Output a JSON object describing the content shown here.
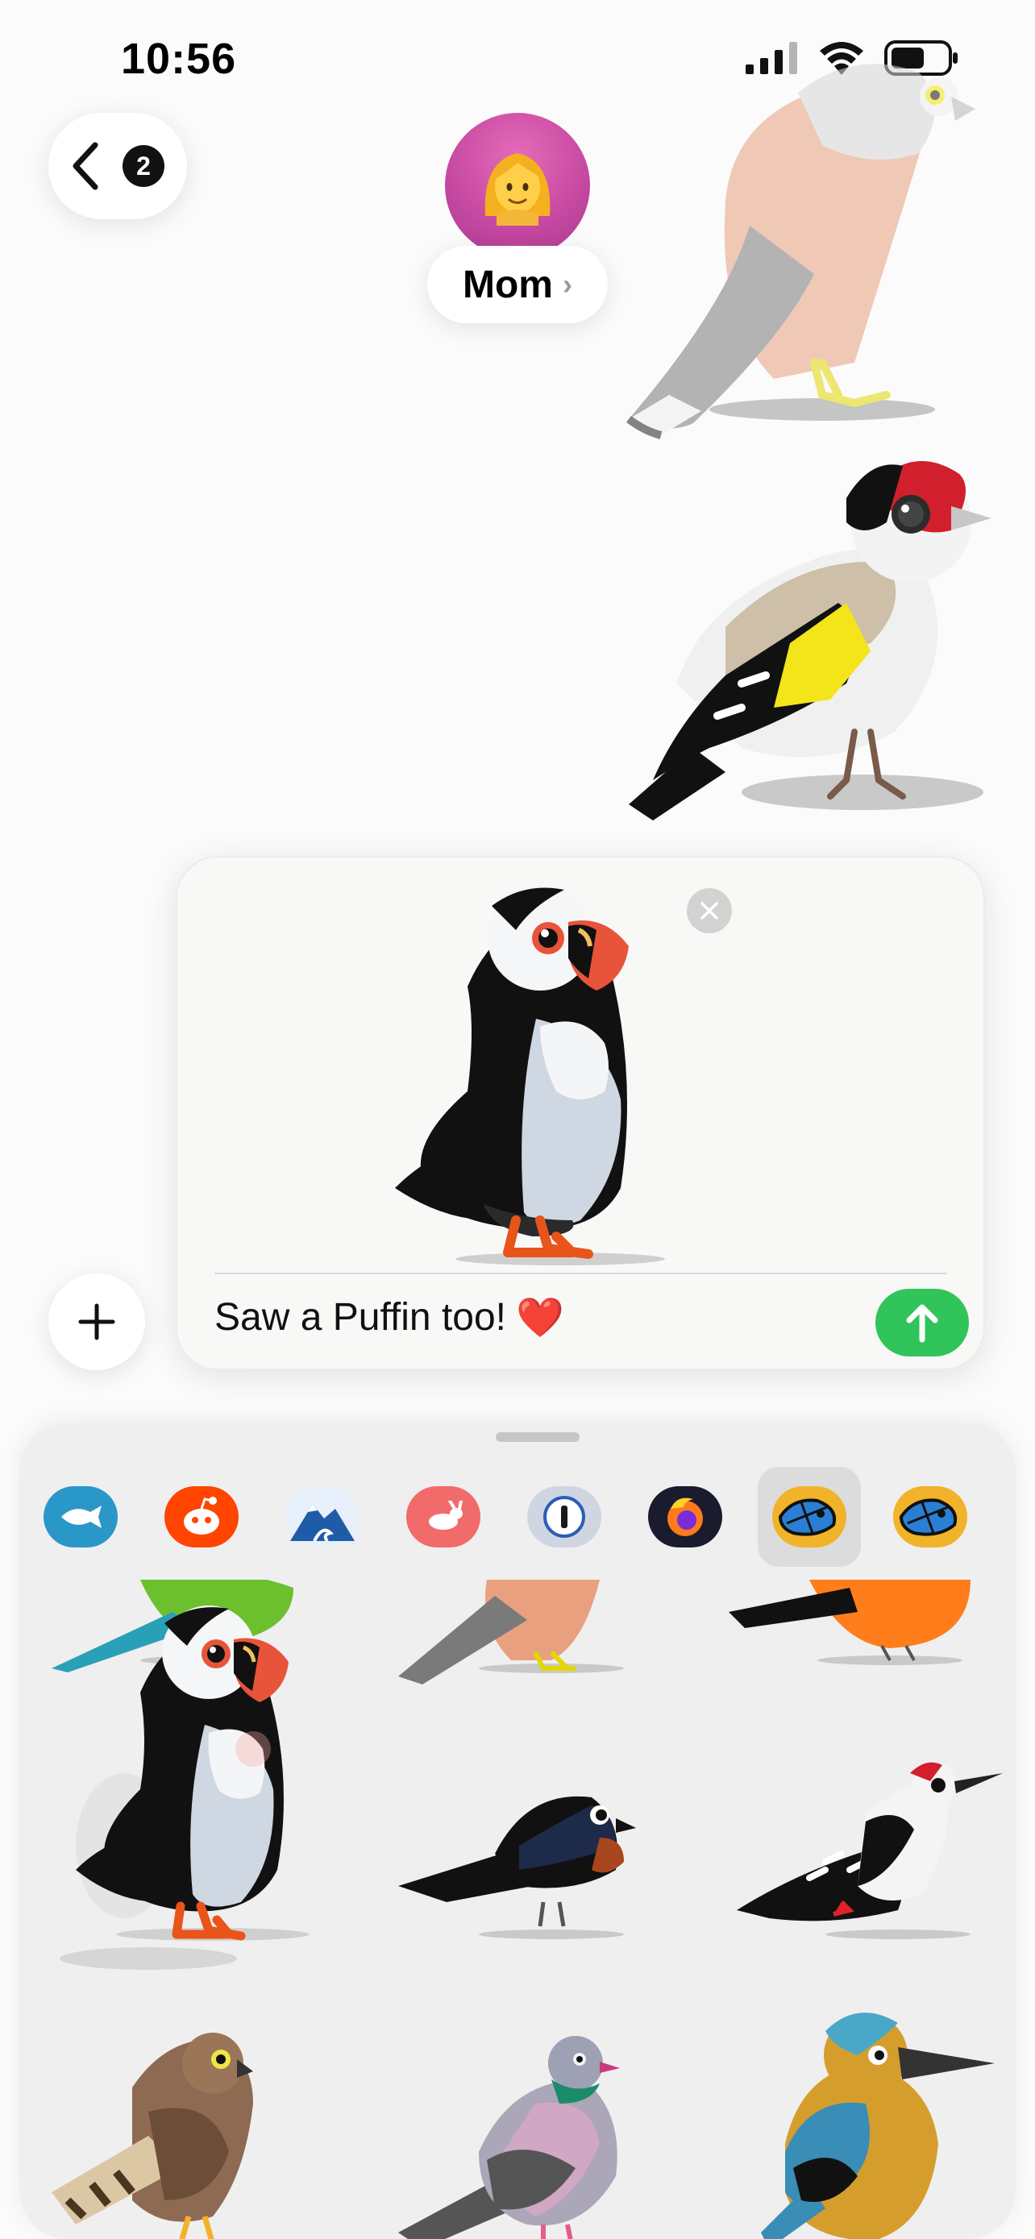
{
  "status_bar": {
    "time": "10:56"
  },
  "header": {
    "unread_count": "2",
    "contact_name": "Mom",
    "avatar_emoji": "👩"
  },
  "compose": {
    "text": "Saw a Puffin too!",
    "emoji": "❤️"
  },
  "thread_stickers": [
    "kestrel-sticker",
    "goldfinch-sticker"
  ],
  "drawer": {
    "apps": [
      {
        "name": "fishing-app-icon",
        "color": "#2a97c9"
      },
      {
        "name": "reddit-app-icon",
        "color": "#ff4500"
      },
      {
        "name": "mountain-app-icon",
        "color": "#e7f0fb"
      },
      {
        "name": "rabbit-app-icon",
        "color": "#f26b6b"
      },
      {
        "name": "password-app-icon",
        "color": "#cfd6e2"
      },
      {
        "name": "firefox-app-icon",
        "color": "#1b1b2e"
      },
      {
        "name": "bird-stickers-app-icon",
        "color": "#f1b329"
      },
      {
        "name": "bird-stickers-alt-app-icon",
        "color": "#f1b329"
      }
    ],
    "stickers": [
      "parakeet",
      "kestrel",
      "robin",
      "puffin",
      "swallow",
      "woodpecker",
      "buzzard",
      "pigeon",
      "kingfisher"
    ]
  },
  "colors": {
    "send": "#31c45b",
    "avatar": "#c447a0",
    "puffin_beak": "#e8543a"
  }
}
